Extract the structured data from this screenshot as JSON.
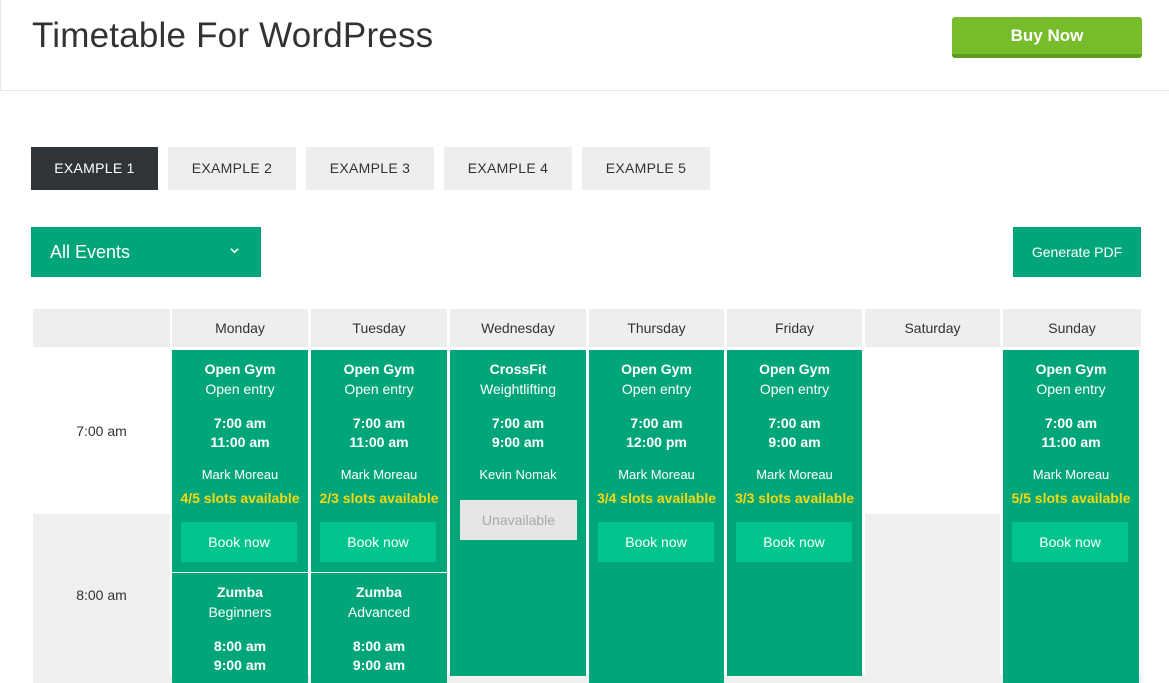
{
  "header": {
    "title": "Timetable For WordPress",
    "buy_label": "Buy Now"
  },
  "tabs": [
    "EXAMPLE 1",
    "EXAMPLE 2",
    "EXAMPLE 3",
    "EXAMPLE 4",
    "EXAMPLE 5"
  ],
  "active_tab": "EXAMPLE 1",
  "filter": {
    "selected": "All Events"
  },
  "pdf_label": "Generate PDF",
  "days": [
    "Monday",
    "Tuesday",
    "Wednesday",
    "Thursday",
    "Friday",
    "Saturday",
    "Sunday"
  ],
  "times": [
    "7:00 am",
    "8:00 am"
  ],
  "events": [
    {
      "day": "Monday",
      "title": "Open Gym",
      "sub": "Open entry",
      "start": "7:00 am",
      "end": "11:00 am",
      "host": "Mark Moreau",
      "slots": "4/5 slots available",
      "action": "Book now"
    },
    {
      "day": "Tuesday",
      "title": "Open Gym",
      "sub": "Open entry",
      "start": "7:00 am",
      "end": "11:00 am",
      "host": "Mark Moreau",
      "slots": "2/3 slots available",
      "action": "Book now"
    },
    {
      "day": "Wednesday",
      "title": "CrossFit",
      "sub": "Weightlifting",
      "start": "7:00 am",
      "end": "9:00 am",
      "host": "Kevin Nomak",
      "slots": "",
      "action": "Unavailable"
    },
    {
      "day": "Thursday",
      "title": "Open Gym",
      "sub": "Open entry",
      "start": "7:00 am",
      "end": "12:00 pm",
      "host": "Mark Moreau",
      "slots": "3/4 slots available",
      "action": "Book now"
    },
    {
      "day": "Friday",
      "title": "Open Gym",
      "sub": "Open entry",
      "start": "7:00 am",
      "end": "9:00 am",
      "host": "Mark Moreau",
      "slots": "3/3 slots available",
      "action": "Book now"
    },
    {
      "day": "Sunday",
      "title": "Open Gym",
      "sub": "Open entry",
      "start": "7:00 am",
      "end": "11:00 am",
      "host": "Mark Moreau",
      "slots": "5/5 slots available",
      "action": "Book now"
    },
    {
      "day": "Monday",
      "title": "Zumba",
      "sub": "Beginners",
      "start": "8:00 am",
      "end": "9:00 am"
    },
    {
      "day": "Tuesday",
      "title": "Zumba",
      "sub": "Advanced",
      "start": "8:00 am",
      "end": "9:00 am"
    }
  ],
  "colors": {
    "event_bg": "#00a67a",
    "book_bg": "#00c48d",
    "slots_text": "#f4d90b",
    "buy_bg": "#76bc2b",
    "active_tab_bg": "#30353a"
  }
}
